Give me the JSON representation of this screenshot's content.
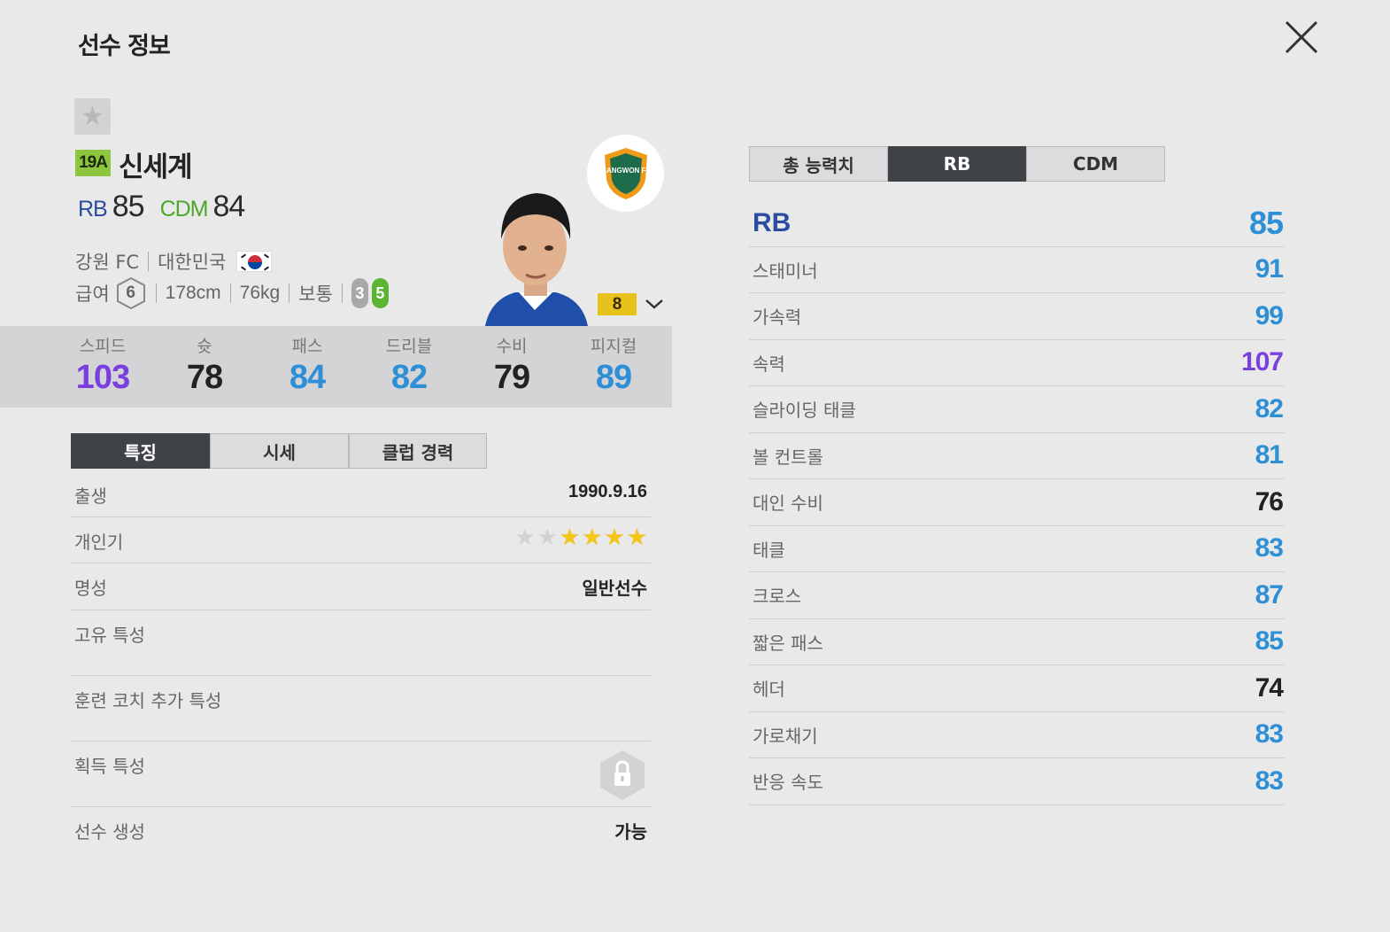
{
  "page": {
    "title": "선수 정보"
  },
  "player": {
    "season": "19A",
    "name": "신세계",
    "positions": [
      {
        "pos": "RB",
        "ovr": "85"
      },
      {
        "pos": "CDM",
        "ovr": "84"
      }
    ],
    "club": "강원 FC",
    "nation": "대한민국",
    "salary_label": "급여",
    "salary": "6",
    "height": "178cm",
    "weight": "76kg",
    "body_type": "보통",
    "weak_foot": "3",
    "strong_foot": "5",
    "enhance_level": "8",
    "club_logo_text": "GANGWON FC"
  },
  "summary_stats": [
    {
      "name": "스피드",
      "value": "103",
      "color": "#7a3fe0"
    },
    {
      "name": "슛",
      "value": "78",
      "color": "#222222"
    },
    {
      "name": "패스",
      "value": "84",
      "color": "#2d8fd6"
    },
    {
      "name": "드리블",
      "value": "82",
      "color": "#2d8fd6"
    },
    {
      "name": "수비",
      "value": "79",
      "color": "#222222"
    },
    {
      "name": "피지컬",
      "value": "89",
      "color": "#2d8fd6"
    }
  ],
  "detail_tabs": [
    "특징",
    "시세",
    "클럽 경력"
  ],
  "details": {
    "birth_label": "출생",
    "birth_value": "1990.9.16",
    "popularity_label": "개인기",
    "popularity_stars": 4,
    "popularity_max": 6,
    "reputation_label": "명성",
    "reputation_value": "일반선수",
    "traits_label": "고유 특성",
    "coach_traits_label": "훈련 코치 추가 특성",
    "acquired_traits_label": "획득 특성",
    "create_label": "선수 생성",
    "create_value": "가능"
  },
  "right_tabs": [
    "총 능력치",
    "RB",
    "CDM"
  ],
  "right_panel": {
    "position": "RB",
    "ovr": "85",
    "attributes": [
      {
        "name": "스태미너",
        "value": "91",
        "color": "#2d8fd6"
      },
      {
        "name": "가속력",
        "value": "99",
        "color": "#2d8fd6"
      },
      {
        "name": "속력",
        "value": "107",
        "color": "#7a3fe0"
      },
      {
        "name": "슬라이딩 태클",
        "value": "82",
        "color": "#2d8fd6"
      },
      {
        "name": "볼 컨트롤",
        "value": "81",
        "color": "#2d8fd6"
      },
      {
        "name": "대인 수비",
        "value": "76",
        "color": "#222222"
      },
      {
        "name": "태클",
        "value": "83",
        "color": "#2d8fd6"
      },
      {
        "name": "크로스",
        "value": "87",
        "color": "#2d8fd6"
      },
      {
        "name": "짧은 패스",
        "value": "85",
        "color": "#2d8fd6"
      },
      {
        "name": "헤더",
        "value": "74",
        "color": "#222222"
      },
      {
        "name": "가로채기",
        "value": "83",
        "color": "#2d8fd6"
      },
      {
        "name": "반응 속도",
        "value": "83",
        "color": "#2d8fd6"
      }
    ]
  },
  "icons": [
    "close-icon",
    "favorite-star-icon",
    "korea-flag-icon",
    "salary-hex-icon",
    "chevron-down-icon",
    "lock-icon",
    "club-logo-icon"
  ]
}
